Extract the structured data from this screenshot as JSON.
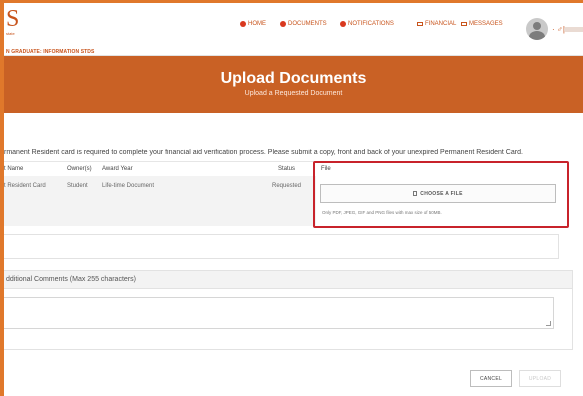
{
  "header": {
    "logo": "S",
    "logo_sub": "state",
    "program": "N GRADUATE: INFORMATION STDS",
    "nav": [
      {
        "label": "HOME",
        "icon": "dot-icon"
      },
      {
        "label": "DOCUMENTS",
        "icon": "dot-icon"
      },
      {
        "label": "NOTIFICATIONS",
        "icon": "dot-icon"
      },
      {
        "label": "FINANCIAL",
        "icon": "envelope-icon"
      },
      {
        "label": "MESSAGES",
        "icon": "envelope-icon"
      }
    ],
    "user_mini": "· ♂|"
  },
  "banner": {
    "title": "Upload Documents",
    "subtitle": "Upload a Requested Document"
  },
  "intro": "rmanent Resident card is required to complete your financial aid verification process. Please submit a copy, front and back of your unexpired Permanent Resident Card.",
  "table": {
    "headers": [
      "t Name",
      "Owner(s)",
      "Award Year",
      "Status",
      "File"
    ],
    "row": {
      "name": "t Resident Card",
      "owner": "Student",
      "award_year": "Life-time Document",
      "status": "Requested"
    }
  },
  "file": {
    "button_label": "CHOOSE A FILE",
    "hint": "Only PDF, JPEG, GIF and PNG files with max size of 50MB."
  },
  "comments": {
    "label": "dditional Comments (Max 255 characters)",
    "value": ""
  },
  "actions": {
    "cancel": "CANCEL",
    "upload": "UPLOAD"
  },
  "colors": {
    "brand": "#c96125",
    "highlight": "#c8232b"
  }
}
